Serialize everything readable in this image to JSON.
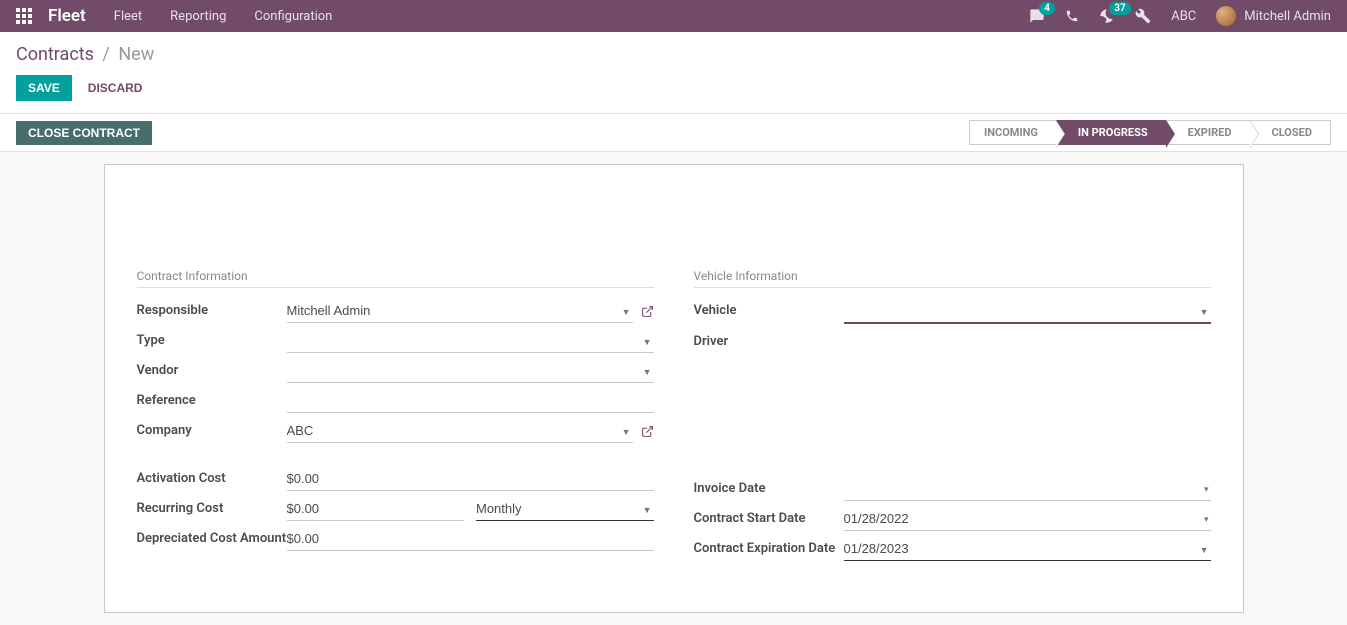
{
  "navbar": {
    "brand": "Fleet",
    "menu": [
      "Fleet",
      "Reporting",
      "Configuration"
    ],
    "msg_badge": "4",
    "activity_badge": "37",
    "company": "ABC",
    "user": "Mitchell Admin"
  },
  "breadcrumb": {
    "root": "Contracts",
    "current": "New"
  },
  "actions": {
    "save": "SAVE",
    "discard": "DISCARD",
    "close_contract": "CLOSE CONTRACT"
  },
  "status": {
    "steps": [
      "INCOMING",
      "IN PROGRESS",
      "EXPIRED",
      "CLOSED"
    ],
    "active_index": 1
  },
  "form": {
    "left_title": "Contract Information",
    "right_title": "Vehicle Information",
    "labels": {
      "responsible": "Responsible",
      "type": "Type",
      "vendor": "Vendor",
      "reference": "Reference",
      "company": "Company",
      "activation_cost": "Activation Cost",
      "recurring_cost": "Recurring Cost",
      "depreciated": "Depreciated Cost Amount",
      "vehicle": "Vehicle",
      "driver": "Driver",
      "invoice_date": "Invoice Date",
      "start_date": "Contract Start Date",
      "exp_date": "Contract Expiration Date"
    },
    "values": {
      "responsible": "Mitchell Admin",
      "type": "",
      "vendor": "",
      "reference": "",
      "company": "ABC",
      "activation_cost": "$0.00",
      "recurring_cost": "$0.00",
      "recurring_period": "Monthly",
      "depreciated": "$0.00",
      "vehicle": "",
      "driver": "",
      "invoice_date": "",
      "start_date": "01/28/2022",
      "exp_date": "01/28/2023"
    }
  }
}
